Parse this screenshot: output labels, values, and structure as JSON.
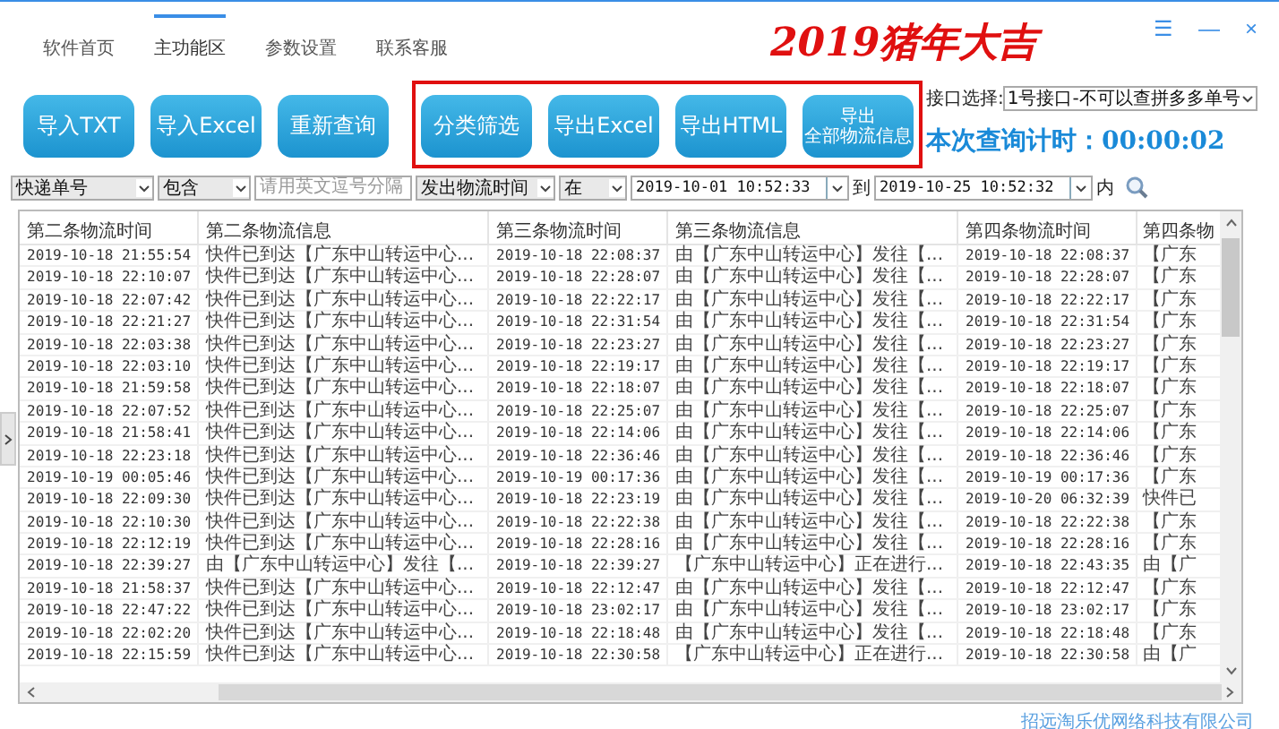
{
  "nav": [
    {
      "label": "软件首页",
      "selected": false
    },
    {
      "label": "主功能区",
      "selected": true
    },
    {
      "label": "参数设置",
      "selected": false
    },
    {
      "label": "联系客服",
      "selected": false
    }
  ],
  "logo": "2019猪年大吉",
  "window_controls": [
    "☰",
    "—",
    "×"
  ],
  "buttons": [
    {
      "lines": [
        "导入TXT"
      ]
    },
    {
      "lines": [
        "导入Excel"
      ]
    },
    {
      "lines": [
        "重新查询"
      ]
    }
  ],
  "highlight_frame": {
    "buttons": [
      {
        "lines": [
          "分类筛选"
        ]
      },
      {
        "lines": [
          "导出Excel"
        ]
      },
      {
        "lines": [
          "导出HTML"
        ]
      },
      {
        "lines": [
          "导出",
          "全部物流信息"
        ]
      }
    ]
  },
  "interface": {
    "label": "接口选择:",
    "value": "1号接口-不可以查拼多多单号"
  },
  "timer": "本次查询计时：00:00:02",
  "filter": {
    "field": "快递单号",
    "match": "包含",
    "placeholder": "请用英文逗号分隔",
    "time_field": "发出物流时间",
    "range": "在",
    "from": "2019-10-01 10:52:33",
    "to_label": "到",
    "to": "2019-10-25 10:52:32",
    "suffix": "内"
  },
  "table": {
    "columns": [
      "第二条物流时间",
      "第二条物流信息",
      "第三条物流时间",
      "第三条物流信息",
      "第四条物流时间",
      "第四条物"
    ],
    "rows": [
      [
        "2019-10-18 21:55:54",
        "快件已到达【广东中山转运中心...",
        "2019-10-18 22:08:37",
        "由【广东中山转运中心】发往【...",
        "2019-10-18 22:08:37",
        "【广东"
      ],
      [
        "2019-10-18 22:10:07",
        "快件已到达【广东中山转运中心...",
        "2019-10-18 22:28:07",
        "由【广东中山转运中心】发往【...",
        "2019-10-18 22:28:07",
        "【广东"
      ],
      [
        "2019-10-18 22:07:42",
        "快件已到达【广东中山转运中心...",
        "2019-10-18 22:22:17",
        "由【广东中山转运中心】发往【...",
        "2019-10-18 22:22:17",
        "【广东"
      ],
      [
        "2019-10-18 22:21:27",
        "快件已到达【广东中山转运中心...",
        "2019-10-18 22:31:54",
        "由【广东中山转运中心】发往【...",
        "2019-10-18 22:31:54",
        "【广东"
      ],
      [
        "2019-10-18 22:03:38",
        "快件已到达【广东中山转运中心...",
        "2019-10-18 22:23:27",
        "由【广东中山转运中心】发往【...",
        "2019-10-18 22:23:27",
        "【广东"
      ],
      [
        "2019-10-18 22:03:10",
        "快件已到达【广东中山转运中心...",
        "2019-10-18 22:19:17",
        "由【广东中山转运中心】发往【...",
        "2019-10-18 22:19:17",
        "【广东"
      ],
      [
        "2019-10-18 21:59:58",
        "快件已到达【广东中山转运中心...",
        "2019-10-18 22:18:07",
        "由【广东中山转运中心】发往【...",
        "2019-10-18 22:18:07",
        "【广东"
      ],
      [
        "2019-10-18 22:07:52",
        "快件已到达【广东中山转运中心...",
        "2019-10-18 22:25:07",
        "由【广东中山转运中心】发往【...",
        "2019-10-18 22:25:07",
        "【广东"
      ],
      [
        "2019-10-18 21:58:41",
        "快件已到达【广东中山转运中心...",
        "2019-10-18 22:14:06",
        "由【广东中山转运中心】发往【...",
        "2019-10-18 22:14:06",
        "【广东"
      ],
      [
        "2019-10-18 22:23:18",
        "快件已到达【广东中山转运中心...",
        "2019-10-18 22:36:46",
        "由【广东中山转运中心】发往【...",
        "2019-10-18 22:36:46",
        "【广东"
      ],
      [
        "2019-10-19 00:05:46",
        "快件已到达【广东中山转运中心...",
        "2019-10-19 00:17:36",
        "由【广东中山转运中心】发往【...",
        "2019-10-19 00:17:36",
        "【广东"
      ],
      [
        "2019-10-18 22:09:30",
        "快件已到达【广东中山转运中心...",
        "2019-10-18 22:23:19",
        "由【广东中山转运中心】发往【...",
        "2019-10-20 06:32:39",
        "快件已"
      ],
      [
        "2019-10-18 22:10:30",
        "快件已到达【广东中山转运中心...",
        "2019-10-18 22:22:38",
        "由【广东中山转运中心】发往【...",
        "2019-10-18 22:22:38",
        "【广东"
      ],
      [
        "2019-10-18 22:12:19",
        "快件已到达【广东中山转运中心...",
        "2019-10-18 22:28:16",
        "由【广东中山转运中心】发往【...",
        "2019-10-18 22:28:16",
        "【广东"
      ],
      [
        "2019-10-18 22:39:27",
        "由【广东中山转运中心】发往【...",
        "2019-10-18 22:39:27",
        "【广东中山转运中心】正在进行...",
        "2019-10-18 22:43:35",
        "由【广"
      ],
      [
        "2019-10-18 21:58:37",
        "快件已到达【广东中山转运中心...",
        "2019-10-18 22:12:47",
        "由【广东中山转运中心】发往【...",
        "2019-10-18 22:12:47",
        "【广东"
      ],
      [
        "2019-10-18 22:47:22",
        "快件已到达【广东中山转运中心...",
        "2019-10-18 23:02:17",
        "由【广东中山转运中心】发往【...",
        "2019-10-18 23:02:17",
        "【广东"
      ],
      [
        "2019-10-18 22:02:20",
        "快件已到达【广东中山转运中心...",
        "2019-10-18 22:18:48",
        "由【广东中山转运中心】发往【...",
        "2019-10-18 22:18:48",
        "【广东"
      ],
      [
        "2019-10-18 22:15:59",
        "快件已到达【广东中山转运中心...",
        "2019-10-18 22:30:58",
        "【广东中山转运中心】正在进行...",
        "2019-10-18 22:30:58",
        "由【广"
      ]
    ]
  },
  "footer": "招远淘乐优网络科技有限公司"
}
